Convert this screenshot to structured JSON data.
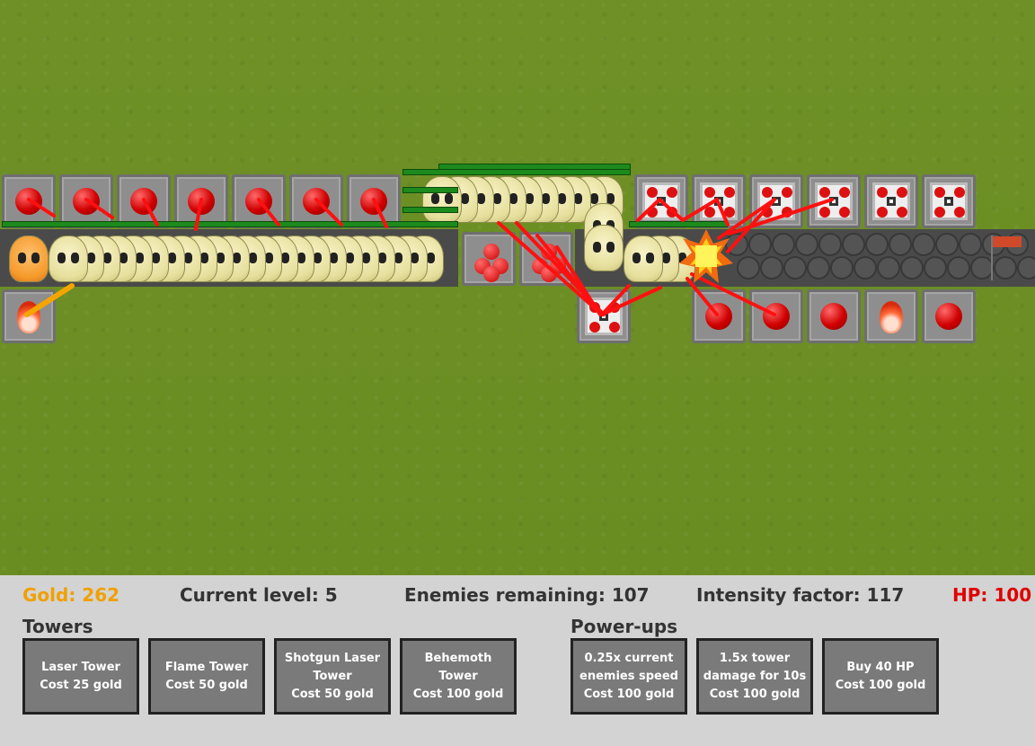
{
  "hud": {
    "gold": "Gold: 262",
    "level": "Current level: 5",
    "enemies": "Enemies remaining: 107",
    "intensity": "Intensity factor: 117",
    "hp": "HP: 100"
  },
  "towers_title": "Towers",
  "powerups_title": "Power-ups",
  "towers": [
    {
      "line1": "Laser Tower",
      "line2": "Cost 25 gold",
      "line3": ""
    },
    {
      "line1": "Flame Tower",
      "line2": "Cost 50 gold",
      "line3": ""
    },
    {
      "line1": "Shotgun Laser",
      "line2": "Tower",
      "line3": "Cost 50 gold"
    },
    {
      "line1": "Behemoth",
      "line2": "Tower",
      "line3": "Cost 100 gold"
    }
  ],
  "powerups": [
    {
      "line1": "0.25x current",
      "line2": "enemies speed",
      "line3": "Cost 100 gold"
    },
    {
      "line1": "1.5x tower",
      "line2": "damage for 10s",
      "line3": "Cost 100 gold"
    },
    {
      "line1": "Buy 40 HP",
      "line2": "Cost 100 gold",
      "line3": ""
    }
  ],
  "colors": {
    "gold": "#f0a000",
    "hp": "#e00000",
    "hud_text": "#333333",
    "hud_bg": "#d3d3d3",
    "grass": "#6b8f24",
    "laser": "#ff1010"
  }
}
